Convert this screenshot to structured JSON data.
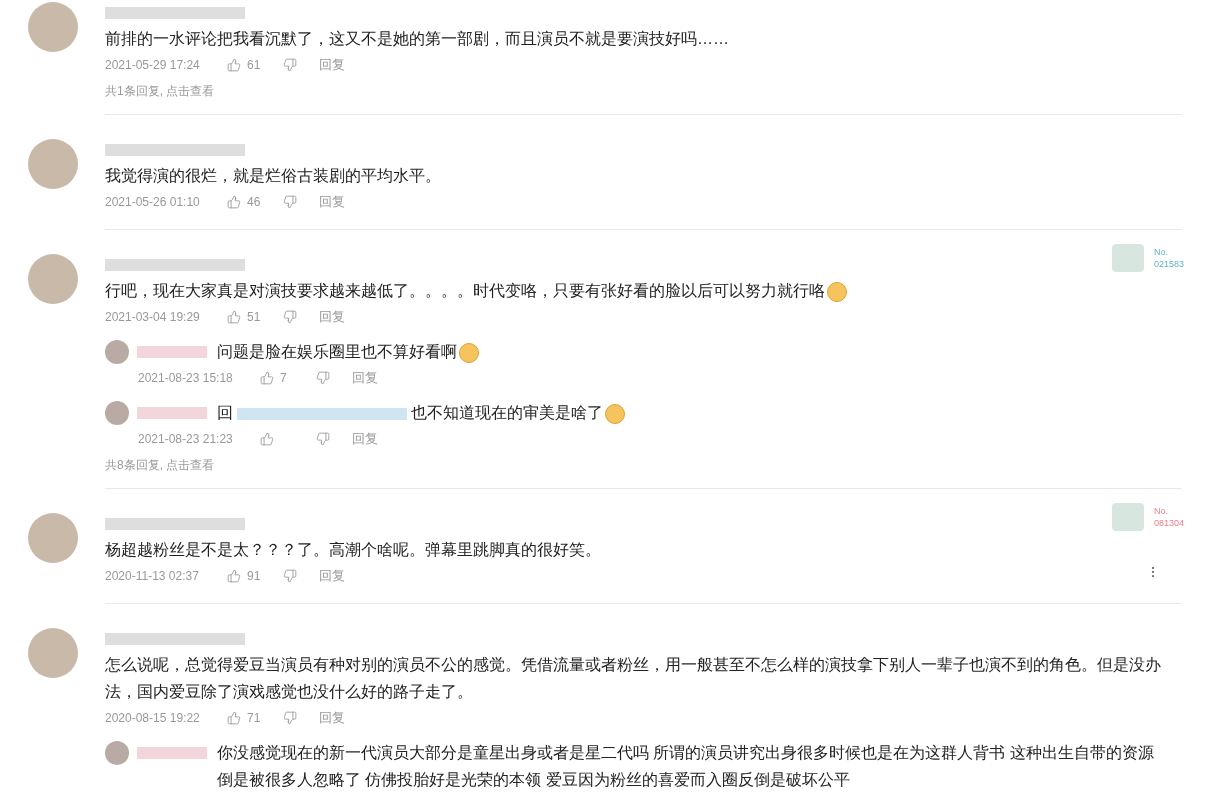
{
  "comments": [
    {
      "text": "前排的一水评论把我看沉默了，这又不是她的第一部剧，而且演员不就是要演技好吗……",
      "emoji": false,
      "date": "2021-05-29 17:24",
      "likes": "61",
      "reply_label": "回复",
      "more_menu": false,
      "more_replies": "共1条回复, 点击查看"
    },
    {
      "text": "我觉得演的很烂，就是烂俗古装剧的平均水平。",
      "emoji": false,
      "date": "2021-05-26 01:10",
      "likes": "46",
      "reply_label": "回复",
      "more_menu": false
    },
    {
      "text": "行吧，现在大家真是对演技要求越来越低了。。。。时代变咯，只要有张好看的脸以后可以努力就行咯",
      "emoji": true,
      "date": "2021-03-04 19:29",
      "likes": "51",
      "reply_label": "回复",
      "more_menu": false,
      "badge": {
        "label": "No.",
        "number": "021583",
        "color": "#5fb4c9"
      },
      "replies": [
        {
          "text": "问题是脸在娱乐圈里也不算好看啊",
          "emoji": true,
          "date": "2021-08-23 15:18",
          "likes": "7",
          "reply_label": "回复"
        },
        {
          "prefix": "回",
          "text": "也不知道现在的审美是啥了",
          "emoji": true,
          "date": "2021-08-23 21:23",
          "reply_label": "回复"
        }
      ],
      "more_replies": "共8条回复, 点击查看"
    },
    {
      "text": "杨超越粉丝是不是太？？？了。高潮个啥呢。弹幕里跳脚真的很好笑。",
      "emoji": false,
      "date": "2020-11-13 02:37",
      "likes": "91",
      "reply_label": "回复",
      "more_menu": true,
      "badge": {
        "label": "No.",
        "number": "081304",
        "color": "#f07c8a"
      }
    },
    {
      "text": "怎么说呢，总觉得爱豆当演员有种对别的演员不公的感觉。凭借流量或者粉丝，用一般甚至不怎么样的演技拿下别人一辈子也演不到的角色。但是没办法，国内爱豆除了演戏感觉也没什么好的路子走了。",
      "emoji": false,
      "date": "2020-08-15 19:22",
      "likes": "71",
      "reply_label": "回复",
      "more_menu": false,
      "replies": [
        {
          "text": "你没感觉现在的新一代演员大部分是童星出身或者是星二代吗 所谓的演员讲究出身很多时候也是在为这群人背书 这种出生自带的资源倒是被很多人忽略了 仿佛投胎好是光荣的本领 爱豆因为粉丝的喜爱而入圈反倒是破坏公平",
          "emoji": false
        }
      ]
    }
  ]
}
